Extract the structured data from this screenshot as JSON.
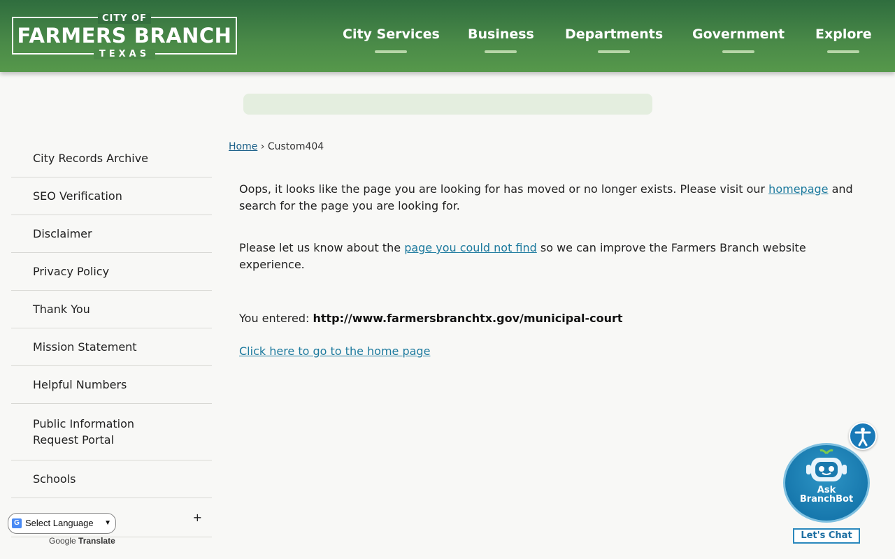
{
  "header": {
    "logo_top": "CITY OF",
    "logo_main": "FARMERS BRANCH",
    "logo_bottom": "TEXAS",
    "nav": [
      "City Services",
      "Business",
      "Departments",
      "Government",
      "Explore"
    ]
  },
  "sidebar": {
    "items": [
      {
        "label": "City Records Archive"
      },
      {
        "label": "SEO Verification"
      },
      {
        "label": "Disclaimer"
      },
      {
        "label": "Privacy Policy"
      },
      {
        "label": "Thank You"
      },
      {
        "label": "Mission Statement"
      },
      {
        "label": "Helpful Numbers"
      },
      {
        "label": "Public Information\nRequest Portal"
      },
      {
        "label": "Schools"
      }
    ],
    "expand_symbol": "+"
  },
  "breadcrumb": {
    "home": "Home",
    "separator": "›",
    "current": "Custom404"
  },
  "content": {
    "p1_before": "Oops, it looks like the page you are looking for has moved or no longer exists. Please visit our ",
    "p1_link": "homepage",
    "p1_after": " and search for the page you are looking for.",
    "p2_before": "Please let us know about the ",
    "p2_link": "page you could not find",
    "p2_after": " so we can improve the Farmers Branch website experience.",
    "entered_label": "You entered: ",
    "entered_url": "http://www.farmersbranchtx.gov/municipal-court",
    "home_link": "Click here to go to the home page"
  },
  "chatbot": {
    "line1": "Ask",
    "line2": "BranchBot",
    "button": "Let's Chat"
  },
  "translate": {
    "select_label": "Select Language",
    "powered_google": "Google",
    "powered_translate": "Translate"
  }
}
